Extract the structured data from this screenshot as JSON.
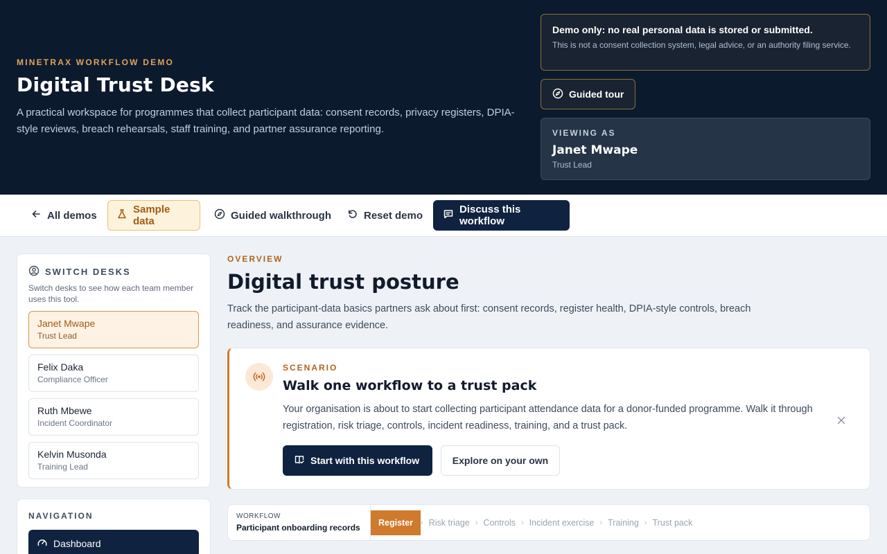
{
  "hero": {
    "eyebrow": "MINETRAX WORKFLOW DEMO",
    "title": "Digital Trust Desk",
    "description": "A practical workspace for programmes that collect participant data: consent records, privacy registers, DPIA-style reviews, breach rehearsals, staff training, and partner assurance reporting."
  },
  "notice": {
    "title": "Demo only: no real personal data is stored or submitted.",
    "body": "This is not a consent collection system, legal advice, or an authority filing service."
  },
  "tour_button": {
    "label": "Guided tour",
    "icon": "compass-icon"
  },
  "viewing_as": {
    "label": "VIEWING AS",
    "name": "Janet Mwape",
    "role": "Trust Lead"
  },
  "toolbar": {
    "all_demos": "All demos",
    "sample_data": "Sample data",
    "guided_walkthrough": "Guided walkthrough",
    "reset_demo": "Reset demo",
    "discuss": "Discuss this workflow"
  },
  "switch_desks": {
    "heading": "SWITCH DESKS",
    "description": "Switch desks to see how each team member uses this tool.",
    "people": [
      {
        "name": "Janet Mwape",
        "role": "Trust Lead",
        "active": true
      },
      {
        "name": "Felix Daka",
        "role": "Compliance Officer",
        "active": false
      },
      {
        "name": "Ruth Mbewe",
        "role": "Incident Coordinator",
        "active": false
      },
      {
        "name": "Kelvin Musonda",
        "role": "Training Lead",
        "active": false
      }
    ]
  },
  "navigation": {
    "heading": "NAVIGATION",
    "items": [
      {
        "label": "Dashboard",
        "active": true
      }
    ]
  },
  "overview": {
    "eyebrow": "OVERVIEW",
    "title": "Digital trust posture",
    "description": "Track the participant-data basics partners ask about first: consent records, register health, DPIA-style controls, breach readiness, and assurance evidence."
  },
  "scenario": {
    "eyebrow": "SCENARIO",
    "title": "Walk one workflow to a trust pack",
    "body": "Your organisation is about to start collecting participant attendance data for a donor-funded programme. Walk it through registration, risk triage, controls, incident readiness, training, and a trust pack.",
    "start_label": "Start with this workflow",
    "explore_label": "Explore on your own"
  },
  "workflow": {
    "label": "WORKFLOW",
    "name": "Participant onboarding records",
    "steps": [
      "Register",
      "Risk triage",
      "Controls",
      "Incident exercise",
      "Training",
      "Trust pack"
    ],
    "current_step": "Register"
  },
  "colors": {
    "navy": "#0c1a2e",
    "accent_orange": "#cf7a2c",
    "accent_gold": "#e0a35a",
    "primary_button": "#0f2340"
  }
}
